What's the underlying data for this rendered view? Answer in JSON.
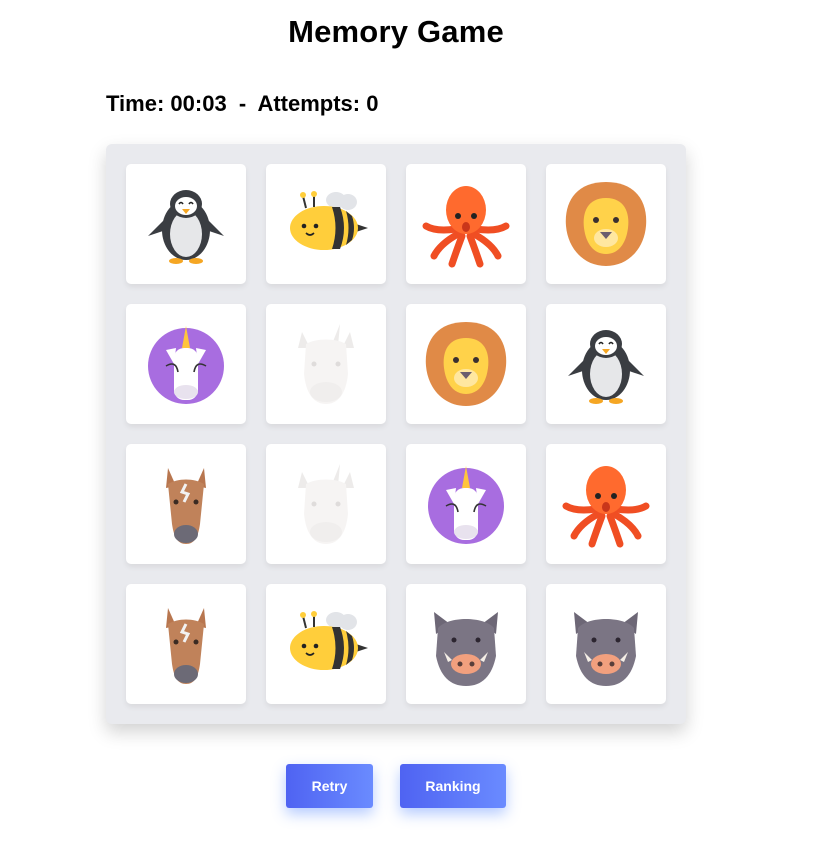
{
  "game": {
    "title": "Memory Game",
    "time_label": "Time:",
    "time": "00:03",
    "attempts_label": "Attempts:",
    "attempts": "0",
    "separator": "-"
  },
  "board": {
    "cards": [
      {
        "animal": "penguin",
        "state": "revealed"
      },
      {
        "animal": "bee",
        "state": "revealed"
      },
      {
        "animal": "octopus",
        "state": "revealed"
      },
      {
        "animal": "lion",
        "state": "revealed"
      },
      {
        "animal": "unicorn",
        "state": "revealed"
      },
      {
        "animal": "rhino",
        "state": "matched"
      },
      {
        "animal": "lion",
        "state": "revealed"
      },
      {
        "animal": "penguin",
        "state": "revealed"
      },
      {
        "animal": "horse",
        "state": "revealed"
      },
      {
        "animal": "rhino",
        "state": "matched"
      },
      {
        "animal": "unicorn",
        "state": "revealed"
      },
      {
        "animal": "octopus",
        "state": "revealed"
      },
      {
        "animal": "horse",
        "state": "revealed"
      },
      {
        "animal": "bee",
        "state": "revealed"
      },
      {
        "animal": "boar",
        "state": "revealed"
      },
      {
        "animal": "boar",
        "state": "revealed"
      }
    ]
  },
  "buttons": {
    "retry": "Retry",
    "ranking": "Ranking"
  },
  "colors": {
    "button_start": "#4f63f2",
    "button_end": "#6a8bff",
    "board_bg": "#e9eaee"
  }
}
